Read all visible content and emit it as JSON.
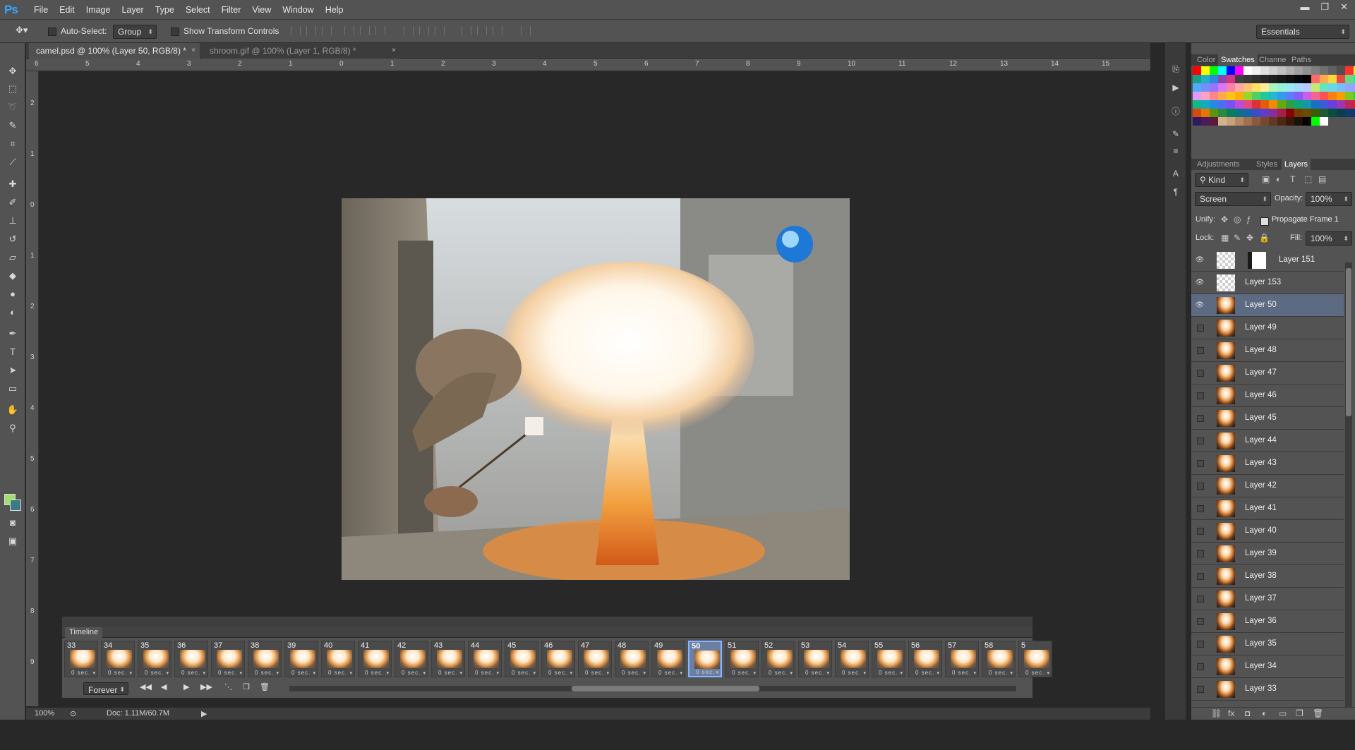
{
  "app": {
    "logo": "Ps"
  },
  "menu": [
    "File",
    "Edit",
    "Image",
    "Layer",
    "Type",
    "Select",
    "Filter",
    "View",
    "Window",
    "Help"
  ],
  "window_controls": {
    "minimize": "▬",
    "restore": "❐",
    "close": "✕"
  },
  "options": {
    "auto_select_label": "Auto-Select:",
    "auto_select_value": "Group",
    "show_transform_label": "Show Transform Controls",
    "workspace": "Essentials"
  },
  "tabs": [
    {
      "label": "camel.psd @ 100% (Layer 50, RGB/8) *",
      "close": "×"
    },
    {
      "label": "shroom.gif @ 100% (Layer 1, RGB/8) *",
      "close": "×"
    }
  ],
  "rulers": {
    "h_ticks": [
      "6",
      "5",
      "4",
      "3",
      "2",
      "1",
      "0",
      "1",
      "2",
      "3",
      "4",
      "5",
      "6",
      "7",
      "8",
      "9",
      "10",
      "11",
      "12",
      "13",
      "14",
      "15"
    ],
    "v_ticks": [
      "2",
      "1",
      "0",
      "1",
      "2",
      "3",
      "4",
      "5",
      "6",
      "7",
      "8",
      "9"
    ]
  },
  "status": {
    "zoom": "100%",
    "doc": "Doc: 1.11M/60.7M"
  },
  "timeline": {
    "title": "Timeline",
    "frames": [
      "33",
      "34",
      "35",
      "36",
      "37",
      "38",
      "39",
      "40",
      "41",
      "42",
      "43",
      "44",
      "45",
      "46",
      "47",
      "48",
      "49",
      "50",
      "51",
      "52",
      "53",
      "54",
      "55",
      "56",
      "57",
      "58",
      "5"
    ],
    "selected_frame": "50",
    "frame_delay": "0 sec.",
    "loop": "Forever"
  },
  "color_panel": {
    "tabs": [
      "Color",
      "Swatches",
      "Channe",
      "Paths"
    ],
    "active": "Swatches"
  },
  "swatches": [
    "#ff0000",
    "#ffff00",
    "#00ff00",
    "#00ffff",
    "#0000ff",
    "#ff00ff",
    "#ffffff",
    "#f0f0f0",
    "#e0e0e0",
    "#d0d0d0",
    "#c0c0c0",
    "#b0b0b0",
    "#a0a0a0",
    "#909090",
    "#808080",
    "#707070",
    "#606060",
    "#505050",
    "#ff3030",
    "#ffee33",
    "#16a085",
    "#1fb2c5",
    "#2e86de",
    "#8e44ad",
    "#d63384",
    "#404040",
    "#383838",
    "#303030",
    "#282828",
    "#202020",
    "#181818",
    "#101010",
    "#080808",
    "#000000",
    "#ff6b6b",
    "#ffa94d",
    "#ffd43b",
    "#e74c3c",
    "#69db7c",
    "#38d9a9",
    "#4dabf7",
    "#748ffc",
    "#9775fa",
    "#da77f2",
    "#f783ac",
    "#ffa8a8",
    "#ffc078",
    "#ffe066",
    "#ffec99",
    "#b2f2bb",
    "#96f2d7",
    "#99e9f2",
    "#a5d8ff",
    "#bac8ff",
    "#c0eb75",
    "#63e6be",
    "#66d9e8",
    "#74c0fc",
    "#91a7ff",
    "#b197fc",
    "#e599f7",
    "#faa2c1",
    "#ff8787",
    "#ffa94d",
    "#fcc419",
    "#fab005",
    "#94d82d",
    "#51cf66",
    "#20c997",
    "#22b8cf",
    "#339af0",
    "#5c7cfa",
    "#845ef7",
    "#cc5de8",
    "#f06595",
    "#fa5252",
    "#fd7e14",
    "#f59f00",
    "#82c91e",
    "#40c057",
    "#12b886",
    "#15aabf",
    "#228be6",
    "#4c6ef5",
    "#7950f2",
    "#be4bdb",
    "#e64980",
    "#e03131",
    "#e8590c",
    "#f08c00",
    "#66a80f",
    "#2f9e44",
    "#0ca678",
    "#1098ad",
    "#1971c2",
    "#3b5bdb",
    "#6741d9",
    "#9c36b5",
    "#c2255c",
    "#c92a2a",
    "#d9480f",
    "#e67700",
    "#5c940d",
    "#2b8a3e",
    "#087f5b",
    "#0b7285",
    "#1864ab",
    "#364fc7",
    "#5f3dc4",
    "#862e9c",
    "#a61e4d",
    "#8b0000",
    "#7a3b00",
    "#6b4c00",
    "#3e5c00",
    "#1d5c2e",
    "#0a4d3c",
    "#0a3d4d",
    "#123a6b",
    "#1f2a6b",
    "#2e1a5c",
    "#4a1a5c",
    "#5c1a3a",
    "#d2b48c",
    "#c8a27a",
    "#b58863",
    "#a0714f",
    "#8b5a3c",
    "#76492e",
    "#613820",
    "#4c2813",
    "#37190a",
    "#1a1208",
    "#000000",
    "#00ff00",
    "#ffffff"
  ],
  "adj_panel": {
    "tabs": [
      "Adjustments",
      "Styles",
      "Layers"
    ],
    "active": "Layers"
  },
  "layers_panel": {
    "filter_kind": "Kind",
    "blend_mode": "Screen",
    "opacity_label": "Opacity:",
    "opacity": "100%",
    "unify_label": "Unify:",
    "propagate_label": "Propagate Frame 1",
    "lock_label": "Lock:",
    "fill_label": "Fill:",
    "fill": "100%",
    "layers": [
      {
        "name": "Layer 151",
        "visible": true,
        "thumb": "transparent",
        "mask": true
      },
      {
        "name": "Layer 153",
        "visible": true,
        "thumb": "transparent"
      },
      {
        "name": "Layer 50",
        "visible": true,
        "thumb": "explosion",
        "selected": true
      },
      {
        "name": "Layer 49",
        "visible": false,
        "thumb": "explosion"
      },
      {
        "name": "Layer 48",
        "visible": false,
        "thumb": "explosion"
      },
      {
        "name": "Layer 47",
        "visible": false,
        "thumb": "explosion"
      },
      {
        "name": "Layer 46",
        "visible": false,
        "thumb": "explosion"
      },
      {
        "name": "Layer 45",
        "visible": false,
        "thumb": "explosion"
      },
      {
        "name": "Layer 44",
        "visible": false,
        "thumb": "explosion"
      },
      {
        "name": "Layer 43",
        "visible": false,
        "thumb": "explosion"
      },
      {
        "name": "Layer 42",
        "visible": false,
        "thumb": "explosion"
      },
      {
        "name": "Layer 41",
        "visible": false,
        "thumb": "explosion"
      },
      {
        "name": "Layer 40",
        "visible": false,
        "thumb": "explosion"
      },
      {
        "name": "Layer 39",
        "visible": false,
        "thumb": "explosion"
      },
      {
        "name": "Layer 38",
        "visible": false,
        "thumb": "explosion"
      },
      {
        "name": "Layer 37",
        "visible": false,
        "thumb": "explosion"
      },
      {
        "name": "Layer 36",
        "visible": false,
        "thumb": "explosion"
      },
      {
        "name": "Layer 35",
        "visible": false,
        "thumb": "explosion"
      },
      {
        "name": "Layer 34",
        "visible": false,
        "thumb": "explosion"
      },
      {
        "name": "Layer 33",
        "visible": false,
        "thumb": "explosion"
      }
    ]
  }
}
